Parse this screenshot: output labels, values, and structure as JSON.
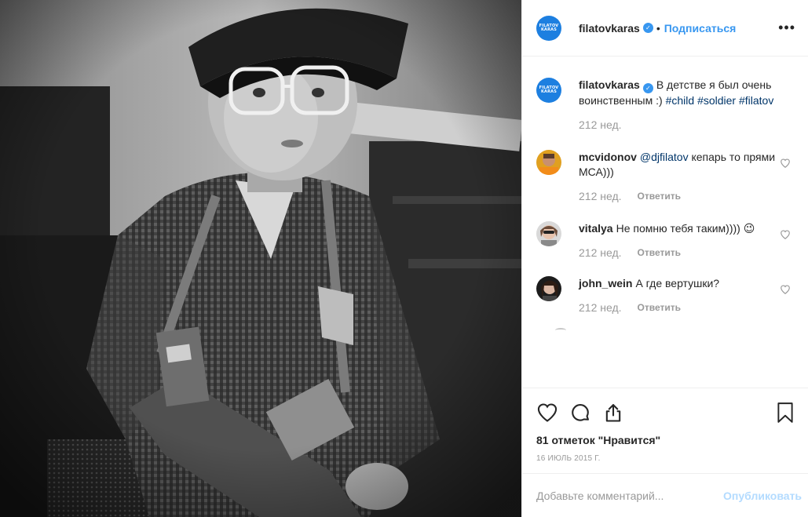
{
  "post": {
    "author": "filatovkaras",
    "logo_text": [
      "FILATOV",
      "KARAS"
    ],
    "separator": "•",
    "follow_label": "Подписаться",
    "more_label": "•••"
  },
  "caption": {
    "username": "filatovkaras",
    "text": "В детстве я был очень воинственным :) ",
    "hashtags": [
      "#child",
      "#soldier",
      "#filatov"
    ],
    "time": "212 нед."
  },
  "comments": [
    {
      "username": "mcvidonov",
      "mention": "@djfilatov",
      "text": " кепарь то прями МСА)))",
      "time": "212 нед.",
      "reply_label": "Ответить"
    },
    {
      "username": "vitalya",
      "text": "Не помню тебя таким)))) 😉",
      "time": "212 нед.",
      "reply_label": "Ответить"
    },
    {
      "username": "john_wein",
      "text": "А где вертушки?",
      "time": "212 нед.",
      "reply_label": "Ответить"
    }
  ],
  "likes": "81 отметок \"Нравится\"",
  "date": "16 ИЮЛЬ 2015 Г.",
  "add_comment": {
    "placeholder": "Добавьте комментарий...",
    "publish_label": "Опубликовать"
  },
  "colors": {
    "accent": "#3897f0",
    "link": "#003569",
    "muted": "#999999",
    "logo_bg": "#1d7fe0",
    "publish_disabled": "#b3dbff"
  },
  "icons": [
    "heart-icon",
    "comment-icon",
    "share-icon",
    "bookmark-icon",
    "more-icon",
    "verified-badge-icon"
  ]
}
